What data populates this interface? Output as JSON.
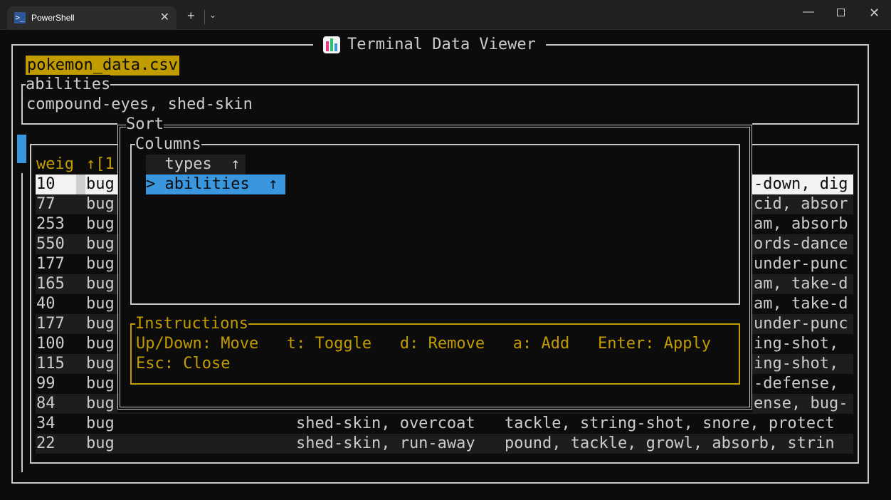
{
  "window": {
    "tab_title": "PowerShell",
    "tab_icon": "powershell-icon",
    "tab_close": "✕",
    "new_tab": "+",
    "dropdown": "⌄",
    "minimize": "—",
    "close": "✕"
  },
  "app": {
    "title": "Terminal Data Viewer",
    "icon": "bar-chart-icon",
    "file_name": "pokemon_data.csv",
    "detail_label": "abilities",
    "detail_value": "compound-eyes, shed-skin",
    "header_weight": "weig",
    "header_sort": "↑[1"
  },
  "rows": [
    {
      "w": "10",
      "t": "bug",
      "mid": "",
      "r": "-down, dig"
    },
    {
      "w": "77",
      "t": "bug",
      "mid": "",
      "r": "cid, absor"
    },
    {
      "w": "253",
      "t": "bug",
      "mid": "",
      "r": "am, absorb"
    },
    {
      "w": "550",
      "t": "bug",
      "mid": "",
      "r": "ords-dance"
    },
    {
      "w": "177",
      "t": "bug",
      "mid": "",
      "r": "under-punc"
    },
    {
      "w": "165",
      "t": "bug",
      "mid": "",
      "r": "am, take-d"
    },
    {
      "w": "40",
      "t": "bug",
      "mid": "",
      "r": "am, take-d"
    },
    {
      "w": "177",
      "t": "bug",
      "mid": "",
      "r": "under-punc"
    },
    {
      "w": "100",
      "t": "bug",
      "mid": "",
      "r": "ing-shot, "
    },
    {
      "w": "115",
      "t": "bug",
      "mid": "",
      "r": "ing-shot, "
    },
    {
      "w": "99",
      "t": "bug",
      "mid": "",
      "r": "-defense, "
    },
    {
      "w": "84",
      "t": "bug",
      "mid": "",
      "r": "ense, bug-"
    },
    {
      "w": "34",
      "t": "bug",
      "mid": "shed-skin, overcoat",
      "r": "tackle, string-shot, snore, protect"
    },
    {
      "w": "22",
      "t": "bug",
      "mid": "shed-skin, run-away",
      "r": "pound, tackle, growl, absorb, strin"
    }
  ],
  "sort_dialog": {
    "title": "Sort",
    "columns_label": "Columns",
    "columns": [
      {
        "label": "  types  ↑"
      },
      {
        "label": "> abilities  ↑"
      }
    ],
    "instructions_label": "Instructions",
    "instructions_line1": "Up/Down: Move   t: Toggle   d: Remove   a: Add   Enter: Apply",
    "instructions_line2": "Esc: Close"
  },
  "colors": {
    "accent_gold": "#c19c00",
    "selection_blue": "#3a96dd",
    "border": "#c8c8c8"
  }
}
